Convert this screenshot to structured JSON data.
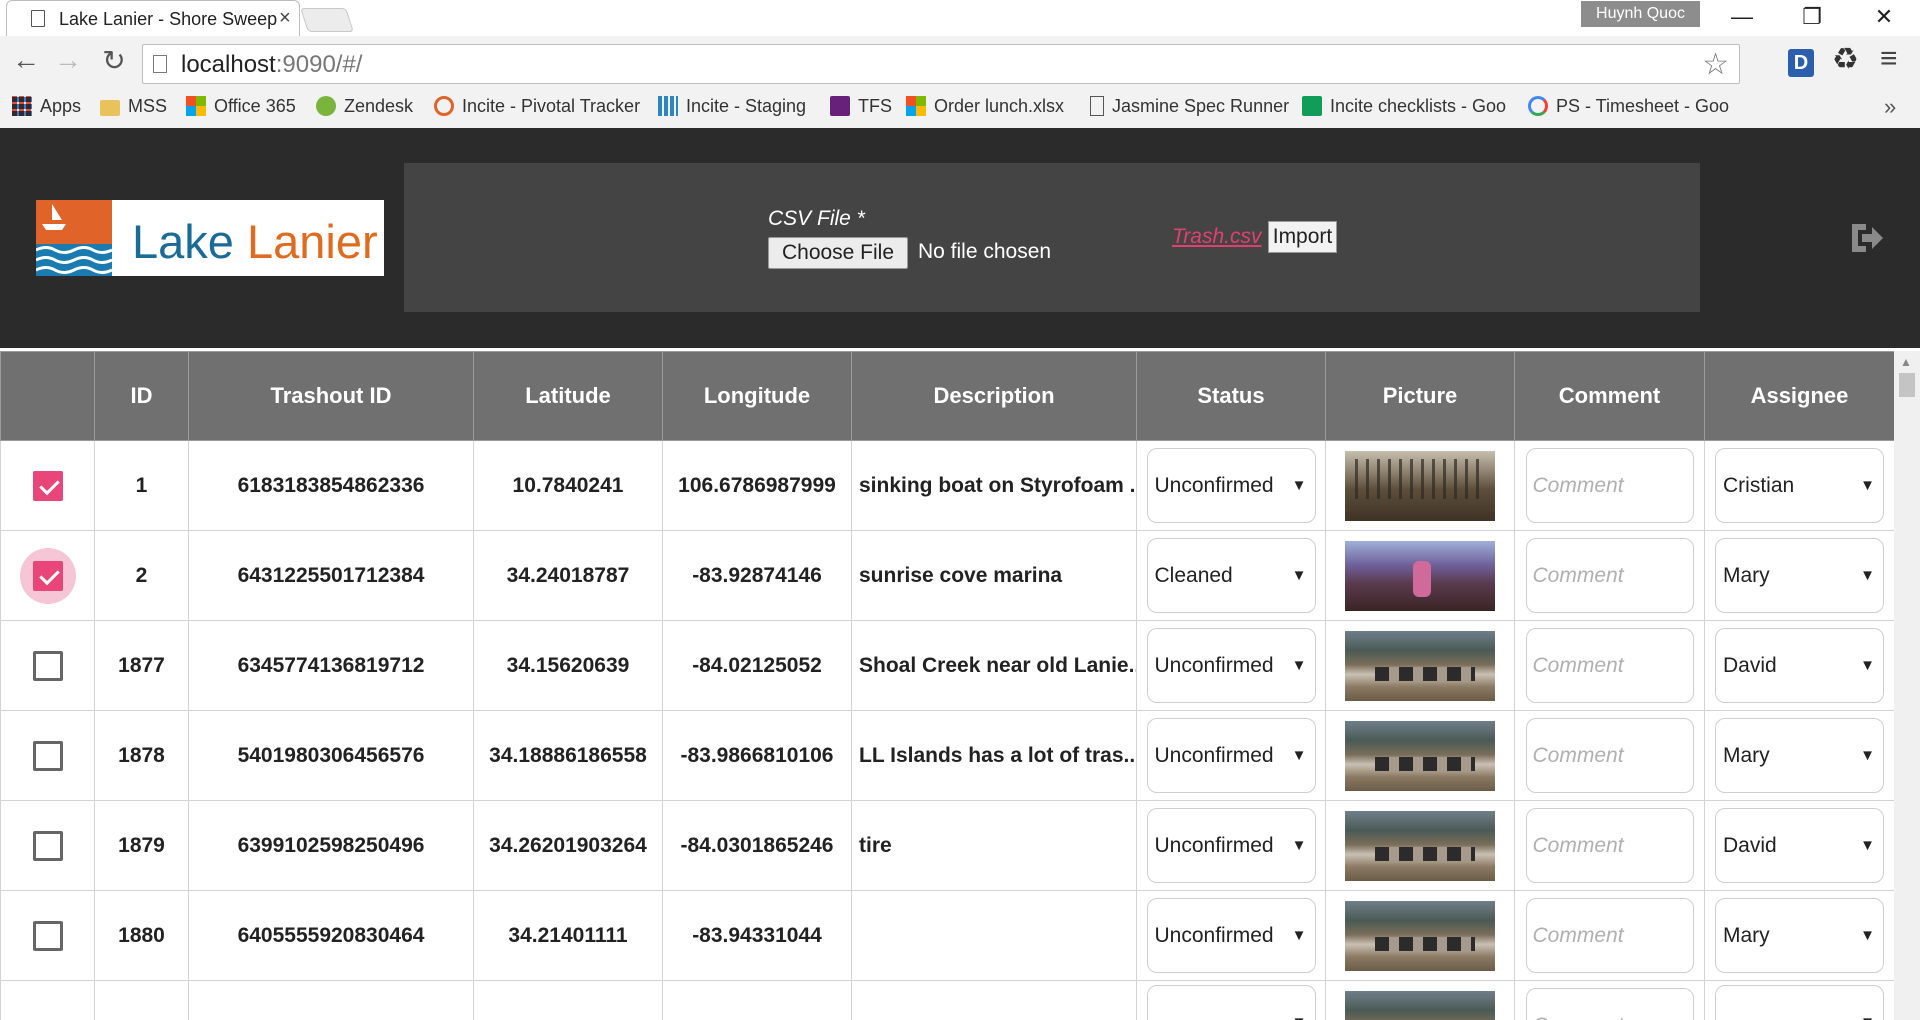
{
  "browser": {
    "tab_title": "Lake Lanier - Shore Sweep",
    "tab_close": "×",
    "profile_name": "Huynh Quoc",
    "url_host": "localhost",
    "url_rest": ":9090/#/",
    "ext_d": "D",
    "bookmarks": [
      {
        "label": "Apps",
        "icon": "apps-grid-icon"
      },
      {
        "label": "MSS",
        "icon": "folder-icon"
      },
      {
        "label": "Office 365",
        "icon": "office365-icon"
      },
      {
        "label": "Zendesk",
        "icon": "zendesk-icon"
      },
      {
        "label": "Incite - Pivotal Tracker",
        "icon": "pivotal-icon"
      },
      {
        "label": "Incite - Staging",
        "icon": "bar-chart-icon"
      },
      {
        "label": "TFS",
        "icon": "visual-studio-icon"
      },
      {
        "label": "Order lunch.xlsx",
        "icon": "office365-icon"
      },
      {
        "label": "Jasmine Spec Runner",
        "icon": "page-icon"
      },
      {
        "label": "Incite checklists - Goo",
        "icon": "sheets-icon"
      },
      {
        "label": "PS - Timesheet - Goo",
        "icon": "google-icon"
      }
    ],
    "bookmarks_more": "»"
  },
  "header": {
    "logo_word1": "Lake",
    "logo_word2": "Lanier",
    "csv_label": "CSV File *",
    "choose_file": "Choose File",
    "no_file": "No file chosen",
    "sample_link": "Trash.csv",
    "import_label": "Import"
  },
  "table": {
    "columns": [
      "",
      "ID",
      "Trashout ID",
      "Latitude",
      "Longitude",
      "Description",
      "Status",
      "Picture",
      "Comment",
      "Assignee"
    ],
    "comment_placeholder": "Comment",
    "rows": [
      {
        "checked": true,
        "focus": false,
        "id": "1",
        "trashout_id": "6183183854862336",
        "lat": "10.7840241",
        "lng": "106.6786987999",
        "desc": "sinking boat on Styrofoam ...",
        "status": "Unconfirmed",
        "pic": "forest",
        "assignee": "Cristian"
      },
      {
        "checked": true,
        "focus": true,
        "id": "2",
        "trashout_id": "6431225501712384",
        "lat": "34.24018787",
        "lng": "-83.92874146",
        "desc": "sunrise cove marina",
        "status": "Cleaned",
        "pic": "sunset",
        "assignee": "Mary"
      },
      {
        "checked": false,
        "focus": false,
        "id": "1877",
        "trashout_id": "6345774136819712",
        "lat": "34.15620639",
        "lng": "-84.02125052",
        "desc": "Shoal Creek near old Lanie...",
        "status": "Unconfirmed",
        "pic": "shore",
        "assignee": "David"
      },
      {
        "checked": false,
        "focus": false,
        "id": "1878",
        "trashout_id": "5401980306456576",
        "lat": "34.18886186558",
        "lng": "-83.9866810106",
        "desc": "LL Islands has a lot of tras...",
        "status": "Unconfirmed",
        "pic": "shore",
        "assignee": "Mary"
      },
      {
        "checked": false,
        "focus": false,
        "id": "1879",
        "trashout_id": "6399102598250496",
        "lat": "34.26201903264",
        "lng": "-84.0301865246",
        "desc": "tire",
        "status": "Unconfirmed",
        "pic": "shore",
        "assignee": "David"
      },
      {
        "checked": false,
        "focus": false,
        "id": "1880",
        "trashout_id": "6405555920830464",
        "lat": "34.21401111",
        "lng": "-83.94331044",
        "desc": "",
        "status": "Unconfirmed",
        "pic": "shore",
        "assignee": "Mary"
      },
      {
        "checked": false,
        "focus": false,
        "id": "",
        "trashout_id": "",
        "lat": "",
        "lng": "",
        "desc": "",
        "status": "",
        "pic": "shore",
        "assignee": ""
      }
    ]
  },
  "colors": {
    "accent_pink": "#e8457a",
    "header_dark": "#2b2b2b",
    "table_header": "#707070",
    "logo_blue": "#1a6b96",
    "logo_orange": "#de6b1f"
  }
}
